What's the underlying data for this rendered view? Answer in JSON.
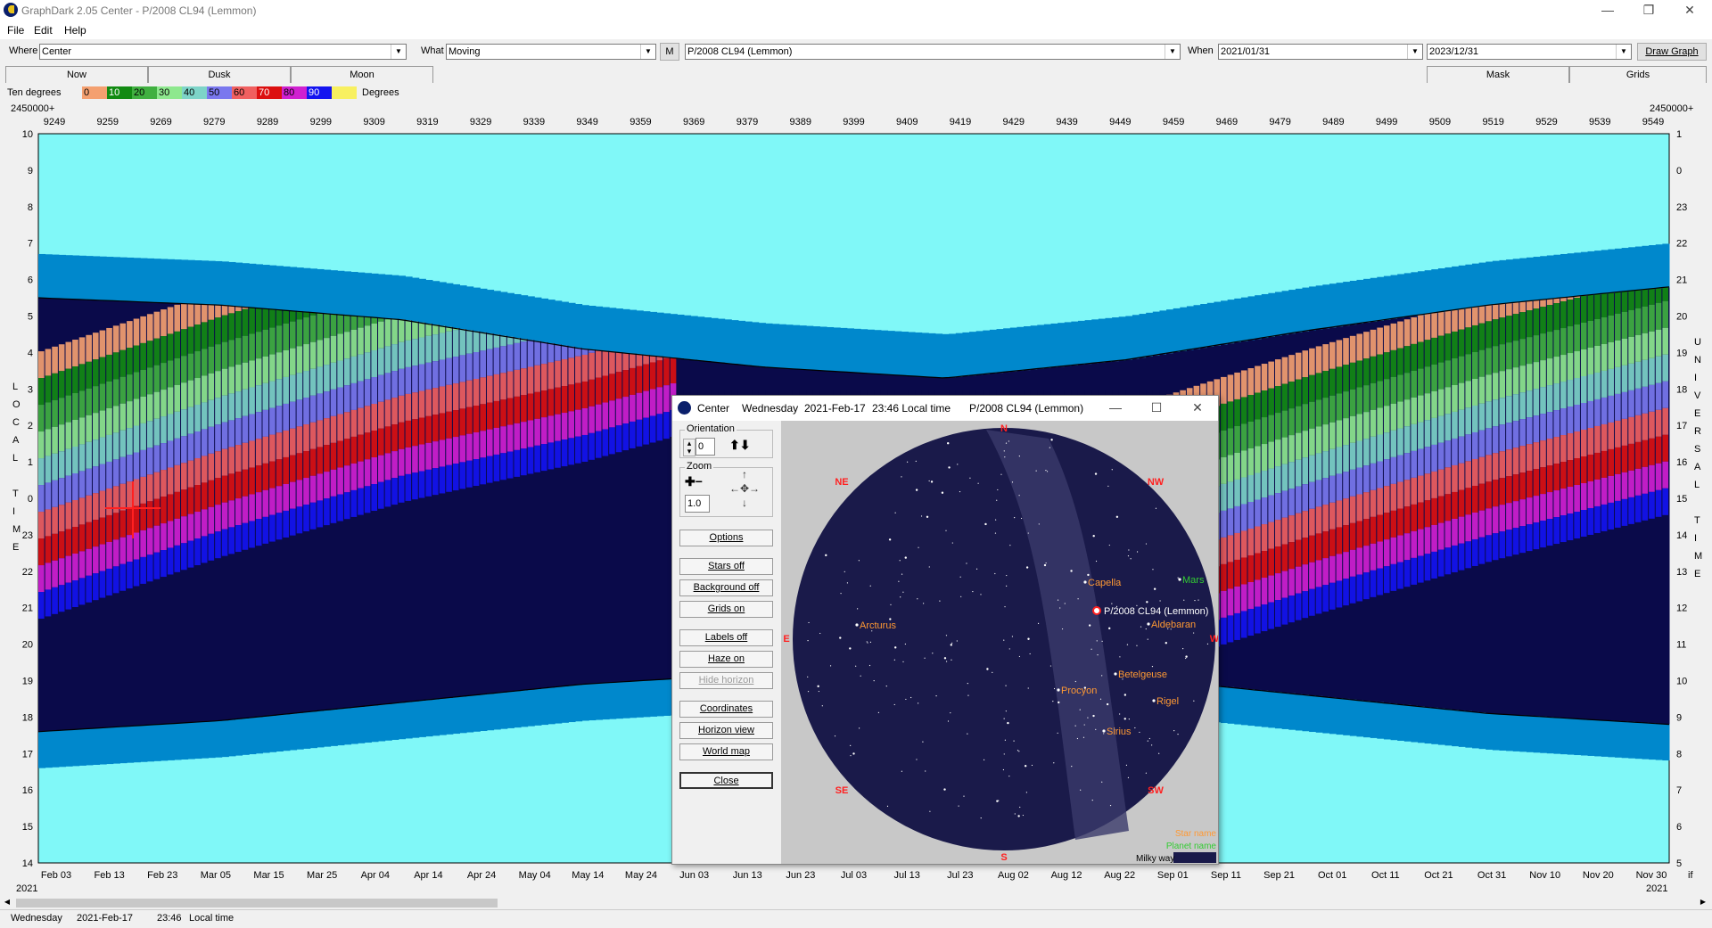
{
  "window": {
    "title": "GraphDark 2.05  Center  -  P/2008 CL94 (Lemmon)",
    "minimize": "—",
    "maximize": "❐",
    "close": "✕"
  },
  "menu": [
    "File",
    "Edit",
    "Help"
  ],
  "toolbar": {
    "where_label": "Where",
    "where_value": "Center",
    "what_label": "What",
    "what_value": "Moving",
    "m_button": "M",
    "object_value": "P/2008 CL94 (Lemmon)",
    "when_label": "When",
    "start_date": "2021/01/31",
    "end_date": "2023/12/31",
    "draw_button": "Draw Graph"
  },
  "tabs": {
    "left": [
      "Now",
      "Dusk",
      "Moon"
    ],
    "right": [
      "Mask",
      "Grids"
    ]
  },
  "legend": {
    "label": "Ten degrees",
    "unit": "Degrees",
    "bins": [
      {
        "label": "0",
        "color": "#f4a070"
      },
      {
        "label": "10",
        "color": "#128a12"
      },
      {
        "label": "20",
        "color": "#40b040"
      },
      {
        "label": "30",
        "color": "#8ee88e"
      },
      {
        "label": "40",
        "color": "#7dd4c8"
      },
      {
        "label": "50",
        "color": "#7a78ee"
      },
      {
        "label": "60",
        "color": "#f06060"
      },
      {
        "label": "70",
        "color": "#dc1010"
      },
      {
        "label": "80",
        "color": "#d020d0"
      },
      {
        "label": "90",
        "color": "#1414f0"
      },
      {
        "label": "",
        "color": "#f8f060"
      }
    ]
  },
  "chart_data": {
    "type": "area",
    "title": "",
    "top_axis_prefix": "2450000+",
    "top_ticks": [
      "9249",
      "9259",
      "9269",
      "9279",
      "9289",
      "9299",
      "9309",
      "9319",
      "9329",
      "9339",
      "9349",
      "9359",
      "9369",
      "9379",
      "9389",
      "9399",
      "9409",
      "9419",
      "9429",
      "9439",
      "9449",
      "9459",
      "9469",
      "9479",
      "9489",
      "9499",
      "9509",
      "9519",
      "9529",
      "9539",
      "9549"
    ],
    "bottom_ticks": [
      "Feb 03",
      "Feb 13",
      "Feb 23",
      "Mar 05",
      "Mar 15",
      "Mar 25",
      "Apr 04",
      "Apr 14",
      "Apr 24",
      "May 04",
      "May 14",
      "May 24",
      "Jun 03",
      "Jun 13",
      "Jun 23",
      "Jul 03",
      "Jul 13",
      "Jul 23",
      "Aug 02",
      "Aug 12",
      "Aug 22",
      "Sep 01",
      "Sep 11",
      "Sep 21",
      "Oct 01",
      "Oct 11",
      "Oct 21",
      "Oct 31",
      "Nov 10",
      "Nov 20",
      "Nov 30"
    ],
    "bottom_end_label": "2021",
    "bottom_start_label": "2021",
    "bottom_right_suffix": "if",
    "left_ticks": [
      "10",
      "9",
      "8",
      "7",
      "6",
      "5",
      "4",
      "3",
      "2",
      "1",
      "0",
      "23",
      "22",
      "21",
      "20",
      "19",
      "18",
      "17",
      "16",
      "15",
      "14"
    ],
    "right_ticks": [
      "1",
      "0",
      "23",
      "22",
      "21",
      "20",
      "19",
      "18",
      "17",
      "16",
      "15",
      "14",
      "13",
      "12",
      "11",
      "10",
      "9",
      "8",
      "7",
      "6",
      "5"
    ],
    "left_axis_label": "LOCAL TIME",
    "right_axis_label": "UNIVERSAL TIME",
    "night_start_hour": [
      5.5,
      5.3,
      4.9,
      4.1,
      3.6,
      3.3,
      3.8,
      4.6,
      5.3,
      5.8
    ],
    "night_end_hour": [
      17.6,
      17.9,
      18.4,
      18.9,
      19.2,
      19.4,
      19.1,
      18.6,
      18.1,
      17.8
    ],
    "background_color": "#80f8f8",
    "night_color": "#0a0a4a",
    "twilight_color": "#0088cc"
  },
  "dialog": {
    "title_app": "Center",
    "title_day": "Wednesday",
    "title_date": "2021-Feb-17",
    "title_time": "23:46 Local time",
    "title_object": "P/2008 CL94 (Lemmon)",
    "orientation_label": "Orientation",
    "orientation_value": "0",
    "zoom_label": "Zoom",
    "zoom_value": "1.0",
    "buttons": [
      "Options",
      "Stars off",
      "Background off",
      "Grids on",
      "Labels off",
      "Haze on",
      "Hide horizon",
      "Coordinates",
      "Horizon view",
      "World map",
      "Close"
    ],
    "directions": {
      "n": "N",
      "ne": "NE",
      "nw": "NW",
      "e": "E",
      "w": "W",
      "se": "SE",
      "sw": "SW",
      "s": "S"
    },
    "stars": [
      {
        "name": "Capella",
        "color": "#ff9933"
      },
      {
        "name": "Aldebaran",
        "color": "#ff9933"
      },
      {
        "name": "Arcturus",
        "color": "#ff9933"
      },
      {
        "name": "Betelgeuse",
        "color": "#ff9933"
      },
      {
        "name": "Rigel",
        "color": "#ff9933"
      },
      {
        "name": "Procyon",
        "color": "#ff9933"
      },
      {
        "name": "Sirius",
        "color": "#ff9933"
      }
    ],
    "planet": {
      "name": "Mars",
      "color": "#33cc33"
    },
    "target": {
      "name": "P/2008 CL94 (Lemmon)"
    },
    "key": {
      "star": "Star name",
      "planet": "Planet name",
      "milky": "Milky way"
    }
  },
  "status": {
    "day": "Wednesday",
    "date": "2021-Feb-17",
    "time": "23:46",
    "zone": "Local time"
  }
}
